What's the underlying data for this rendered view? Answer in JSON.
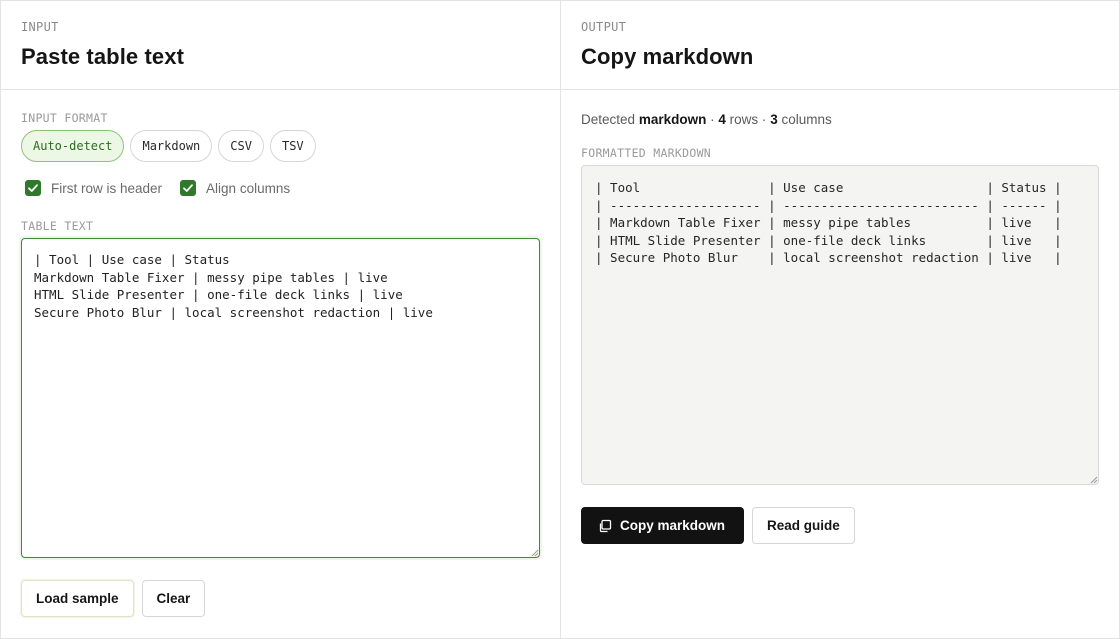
{
  "input_panel": {
    "eyebrow": "INPUT",
    "title": "Paste table text",
    "format_label": "INPUT FORMAT",
    "formats": [
      {
        "label": "Auto-detect",
        "active": true
      },
      {
        "label": "Markdown",
        "active": false
      },
      {
        "label": "CSV",
        "active": false
      },
      {
        "label": "TSV",
        "active": false
      }
    ],
    "options": [
      {
        "label": "First row is header",
        "checked": true
      },
      {
        "label": "Align columns",
        "checked": true
      }
    ],
    "text_label": "TABLE TEXT",
    "text_value": "| Tool | Use case | Status\nMarkdown Table Fixer | messy pipe tables | live\nHTML Slide Presenter | one-file deck links | live\nSecure Photo Blur | local screenshot redaction | live",
    "load_sample_label": "Load sample",
    "clear_label": "Clear"
  },
  "output_panel": {
    "eyebrow": "OUTPUT",
    "title": "Copy markdown",
    "detected_prefix": "Detected",
    "detected_format": "markdown",
    "rows_count": "4",
    "rows_word": "rows",
    "columns_count": "3",
    "columns_word": "columns",
    "formatted_label": "FORMATTED MARKDOWN",
    "formatted_value": "| Tool                 | Use case                   | Status |\n| -------------------- | -------------------------- | ------ |\n| Markdown Table Fixer | messy pipe tables          | live   |\n| HTML Slide Presenter | one-file deck links        | live   |\n| Secure Photo Blur    | local screenshot redaction | live   |",
    "copy_label": "Copy markdown",
    "guide_label": "Read guide"
  },
  "colors": {
    "accent_green": "#2f7a2a",
    "chip_active_bg": "#ecf7e6",
    "primary_button": "#121212"
  },
  "icons": {
    "checkbox": "check-icon",
    "copy": "copy-icon"
  }
}
